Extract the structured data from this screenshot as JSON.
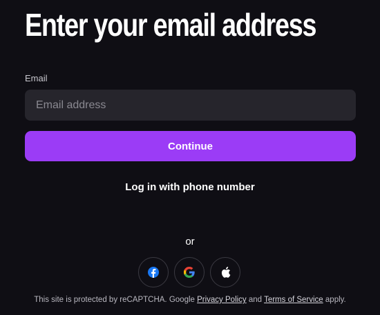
{
  "heading": "Enter your email address",
  "email_field": {
    "label": "Email",
    "placeholder": "Email address"
  },
  "continue_label": "Continue",
  "phone_login_label": "Log in with phone number",
  "divider_text": "or",
  "social": [
    {
      "icon": "facebook-icon",
      "color": "#1877f2"
    },
    {
      "icon": "google-icon",
      "color": "#4285f4"
    },
    {
      "icon": "apple-icon",
      "color": "#ffffff"
    }
  ],
  "footer": {
    "prefix": "This site is protected by reCAPTCHA. Google ",
    "privacy_label": "Privacy Policy",
    "and": " and ",
    "terms_label": "Terms of Service",
    "suffix": " apply."
  },
  "colors": {
    "background": "#0f0e14",
    "accent": "#9b3cf6",
    "input_bg": "#26252c"
  }
}
